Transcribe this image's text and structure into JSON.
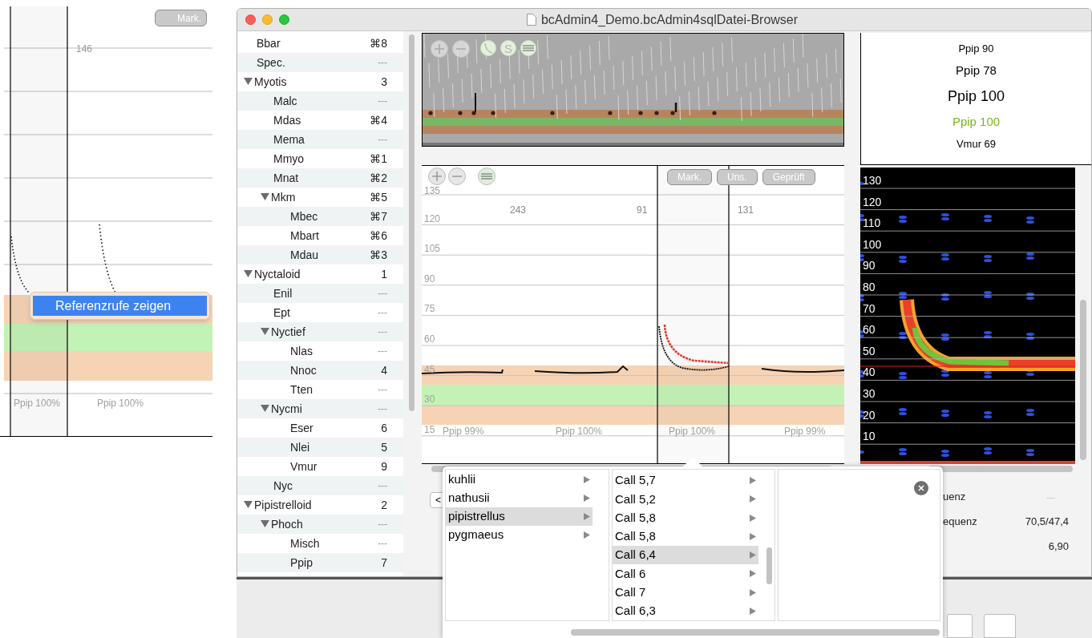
{
  "reference_panel": {
    "button": "Mark.",
    "marker": "146",
    "menu_item": {
      "label": "Referenzrufe zeigen",
      "selected": true
    },
    "call_labels": [
      "Ppip 100%",
      "Ppip 100%"
    ]
  },
  "window": {
    "title": "bcAdmin4_Demo.bcAdmin4sqlDatei-Browser"
  },
  "sidebar": {
    "items": [
      {
        "label": "Bbar",
        "value": "⌘8"
      },
      {
        "label": "Spec.",
        "value": "---"
      },
      {
        "label": "Myotis",
        "value": "3",
        "expanded": true,
        "children": [
          {
            "label": "Malc",
            "value": "---"
          },
          {
            "label": "Mdas",
            "value": "⌘4"
          },
          {
            "label": "Mema",
            "value": "---"
          },
          {
            "label": "Mmyo",
            "value": "⌘1"
          },
          {
            "label": "Mnat",
            "value": "⌘2"
          },
          {
            "label": "Mkm",
            "value": "⌘5",
            "expanded": true,
            "children": [
              {
                "label": "Mbec",
                "value": "⌘7"
              },
              {
                "label": "Mbart",
                "value": "⌘6"
              },
              {
                "label": "Mdau",
                "value": "⌘3"
              }
            ]
          }
        ]
      },
      {
        "label": "Nyctaloid",
        "value": "1",
        "expanded": true,
        "children": [
          {
            "label": "Enil",
            "value": "---"
          },
          {
            "label": "Ept",
            "value": "---"
          },
          {
            "label": "Nyctief",
            "value": "---",
            "expanded": true,
            "children": [
              {
                "label": "Nlas",
                "value": "---"
              },
              {
                "label": "Nnoc",
                "value": "4"
              },
              {
                "label": "Tten",
                "value": "---"
              }
            ]
          },
          {
            "label": "Nycmi",
            "value": "---",
            "expanded": true,
            "children": [
              {
                "label": "Eser",
                "value": "6"
              },
              {
                "label": "Nlei",
                "value": "5"
              },
              {
                "label": "Vmur",
                "value": "9"
              }
            ]
          },
          {
            "label": "Nyc",
            "value": "---"
          }
        ]
      },
      {
        "label": "Pipistrelloid",
        "value": "2",
        "expanded": true,
        "children": [
          {
            "label": "Phoch",
            "value": "---",
            "expanded": true,
            "children": [
              {
                "label": "Misch",
                "value": "---"
              },
              {
                "label": "Ppip",
                "value": "7"
              }
            ]
          }
        ]
      }
    ]
  },
  "overview": {
    "tool_buttons": [
      {
        "kind": "plus"
      },
      {
        "kind": "minus"
      },
      {
        "kind": "curve"
      },
      {
        "kind": "letter",
        "label": "S"
      },
      {
        "kind": "bars"
      }
    ]
  },
  "call_chart": {
    "zoom_buttons": [
      {
        "kind": "plus"
      },
      {
        "kind": "minus"
      },
      {
        "kind": "bars"
      }
    ],
    "buttons": [
      "Mark.",
      "Uns.",
      "Geprüft"
    ],
    "y_labels": [
      "135",
      "120",
      "105",
      "90",
      "75",
      "60",
      "45",
      "30",
      "15"
    ],
    "call_numbers": [
      "243",
      "91",
      "131"
    ],
    "call_labels": [
      "Ppip 99%",
      "Ppip 100%",
      "Ppip 100%",
      "Ppip 99%"
    ]
  },
  "back_button": "<",
  "species_ranking": [
    {
      "label": "Ppip 90",
      "kind": "small",
      "color": "#000000"
    },
    {
      "label": "Ppip 78",
      "kind": "medium",
      "color": "#000000"
    },
    {
      "label": "Ppip 100",
      "kind": "large",
      "color": "#000000"
    },
    {
      "label": "Ppip 100",
      "kind": "medium",
      "color": "#7cb518"
    },
    {
      "label": "Vmur 69",
      "kind": "small",
      "color": "#000000"
    }
  ],
  "spectrogram": {
    "y_labels": [
      "130",
      "120",
      "110",
      "100",
      "90",
      "80",
      "70",
      "60",
      "50",
      "40",
      "30",
      "20",
      "10"
    ]
  },
  "info": [
    {
      "label": "uenz",
      "value": "---"
    },
    {
      "label": "equenz",
      "value": "70,5/47,4"
    },
    {
      "value": "6,90"
    }
  ],
  "reference_browser": {
    "species": [
      {
        "label": "kuhlii",
        "selected": false
      },
      {
        "label": "nathusii",
        "selected": false
      },
      {
        "label": "pipistrellus",
        "selected": true
      },
      {
        "label": "pygmaeus",
        "selected": false
      }
    ],
    "calls": [
      {
        "label": "Call 5,7",
        "selected": false
      },
      {
        "label": "Call 5,2",
        "selected": false
      },
      {
        "label": "Call 5,8",
        "selected": false
      },
      {
        "label": "Call 5,8",
        "selected": false
      },
      {
        "label": "Call 6,4",
        "selected": true
      },
      {
        "label": "Call 6",
        "selected": false
      },
      {
        "label": "Call 7",
        "selected": false
      },
      {
        "label": "Call 6,3",
        "selected": false
      }
    ]
  }
}
